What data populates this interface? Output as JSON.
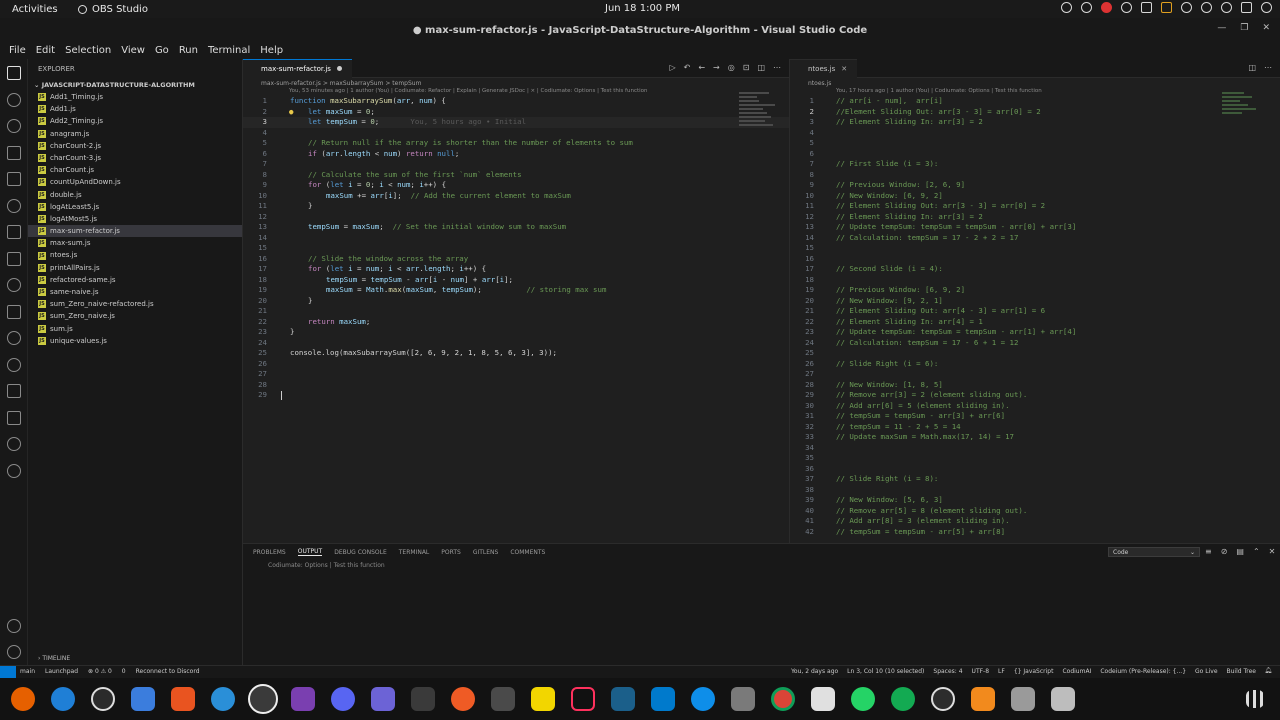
{
  "gnome": {
    "activities": "Activities",
    "app_name": "OBS Studio",
    "clock": "Jun 18  1:00 PM"
  },
  "window": {
    "title": "● max-sum-refactor.js - JavaScript-DataStructure-Algorithm - Visual Studio Code"
  },
  "menu": [
    "File",
    "Edit",
    "Selection",
    "View",
    "Go",
    "Run",
    "Terminal",
    "Help"
  ],
  "explorer": {
    "header": "EXPLORER",
    "folder": "JAVASCRIPT-DATASTRUCTURE-ALGORITHM",
    "files": [
      "Add1_Timing.js",
      "Add1.js",
      "Add2_Timing.js",
      "anagram.js",
      "charCount-2.js",
      "charCount-3.js",
      "charCount.js",
      "countUpAndDown.js",
      "double.js",
      "logAtLeast5.js",
      "logAtMost5.js",
      "max-sum-refactor.js",
      "max-sum.js",
      "ntoes.js",
      "printAllPairs.js",
      "refactored-same.js",
      "same-naive.js",
      "sum_Zero_naive-refactored.js",
      "sum_Zero_naive.js",
      "sum.js",
      "unique-values.js"
    ],
    "active_index": 11,
    "timeline": "TIMELINE"
  },
  "left_editor": {
    "tab": "max-sum-refactor.js",
    "breadcrumb": "max-sum-refactor.js  >  maxSubarraySum  >  tempSum",
    "codelens": "You, 53 minutes ago | 1 author (You) | Codiumate: Refactor | Explain | Generate JSDoc | × | Codiumate: Options | Test this function",
    "ghost_text": "You, 5 hours ago • Initial",
    "console_line": "console.log(maxSubarraySum([2, 6, 9, 2, 1, 8, 5, 6, 3], 3));"
  },
  "right_editor": {
    "tab": "ntoes.js",
    "breadcrumb": "ntoes.js",
    "codelens": "You, 17 hours ago | 1 author (You) | Codiumate: Options | Test this function",
    "lines": [
      "// arr[i - num],  arr[i]",
      "//Element Sliding Out: arr[3 - 3] = arr[0] = 2",
      "// Element Sliding In: arr[3] = 2",
      "",
      "",
      "",
      "// First Slide (i = 3):",
      "",
      "// Previous Window: [2, 6, 9]",
      "// New Window: [6, 9, 2]",
      "// Element Sliding Out: arr[3 - 3] = arr[0] = 2",
      "// Element Sliding In: arr[3] = 2",
      "// Update tempSum: tempSum = tempSum - arr[0] + arr[3]",
      "// Calculation: tempSum = 17 - 2 + 2 = 17",
      "",
      "",
      "// Second Slide (i = 4):",
      "",
      "// Previous Window: [6, 9, 2]",
      "// New Window: [9, 2, 1]",
      "// Element Sliding Out: arr[4 - 3] = arr[1] = 6",
      "// Element Sliding In: arr[4] = 1",
      "// Update tempSum: tempSum = tempSum - arr[1] + arr[4]",
      "// Calculation: tempSum = 17 - 6 + 1 = 12",
      "",
      "// Slide Right (i = 6):",
      "",
      "// New Window: [1, 8, 5]",
      "// Remove arr[3] = 2 (element sliding out).",
      "// Add arr[6] = 5 (element sliding in).",
      "// tempSum = tempSum - arr[3] + arr[6]",
      "// tempSum = 11 - 2 + 5 = 14",
      "// Update maxSum = Math.max(17, 14) = 17",
      "",
      "",
      "",
      "// Slide Right (i = 8):",
      "",
      "// New Window: [5, 6, 3]",
      "// Remove arr[5] = 8 (element sliding out).",
      "// Add arr[8] = 3 (element sliding in).",
      "// tempSum = tempSum - arr[5] + arr[8]"
    ]
  },
  "panel": {
    "tabs": [
      "PROBLEMS",
      "OUTPUT",
      "DEBUG CONSOLE",
      "TERMINAL",
      "PORTS",
      "GITLENS",
      "COMMENTS"
    ],
    "active_tab": "OUTPUT",
    "select_value": "Code",
    "output_line": "Codiumate: Options | Test this function"
  },
  "status": {
    "left": [
      "main",
      "Launchpad",
      "⊗ 0 ⚠ 0",
      "0",
      "Reconnect to Discord"
    ],
    "right": [
      "You, 2 days ago",
      "Ln 3, Col 10 (10 selected)",
      "Spaces: 4",
      "UTF-8",
      "LF",
      "{} JavaScript",
      "CodiumAI",
      "Codeium (Pre-Release): {...}",
      "Go Live",
      "Build Tree"
    ]
  }
}
